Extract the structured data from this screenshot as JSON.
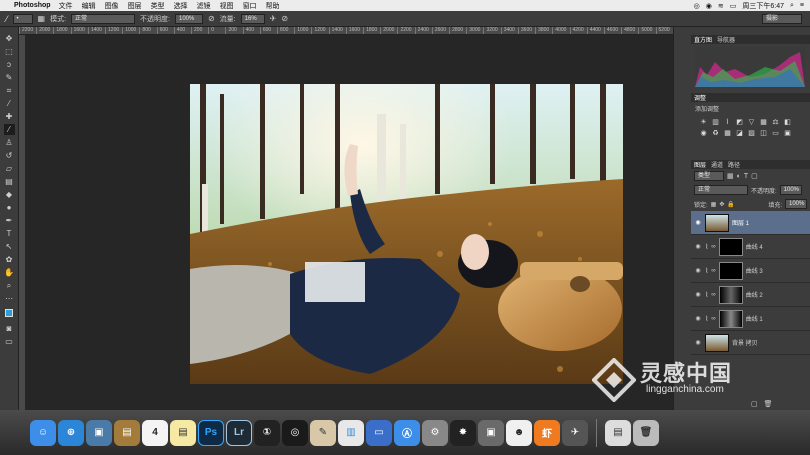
{
  "menubar": {
    "app_name": "Photoshop",
    "items": [
      "文件",
      "编辑",
      "图像",
      "图层",
      "类型",
      "选择",
      "滤镜",
      "视图",
      "窗口",
      "帮助"
    ],
    "clock": "周三下午6:47"
  },
  "options": {
    "mode_label": "模式:",
    "mode_value": "正常",
    "opacity_label": "不透明度:",
    "opacity_value": "100%",
    "flow_label": "流量:",
    "flow_value": "16%",
    "workspace": "摄影"
  },
  "ruler_ticks": [
    "2200",
    "2000",
    "1800",
    "1600",
    "1400",
    "1200",
    "1000",
    "800",
    "600",
    "400",
    "200",
    "0",
    "200",
    "400",
    "600",
    "800",
    "1000",
    "1200",
    "1400",
    "1600",
    "1800",
    "2000",
    "2200",
    "2400",
    "2600",
    "2800",
    "3000",
    "3200",
    "3400",
    "3600",
    "3800",
    "4000",
    "4200",
    "4400",
    "4600",
    "4800",
    "5000",
    "5200"
  ],
  "histogram": {
    "tabs": [
      "直方图",
      "导航器"
    ]
  },
  "adjustments": {
    "tab": "调整",
    "title": "添加调整"
  },
  "layers": {
    "tabs": [
      "图层",
      "通道",
      "路径"
    ],
    "kind_label": "类型",
    "blend_mode": "正常",
    "opacity_label": "不透明度:",
    "opacity_value": "100%",
    "lock_label": "锁定:",
    "fill_label": "填充:",
    "fill_value": "100%",
    "items": [
      {
        "name": "图层 1"
      },
      {
        "name": "曲线 4"
      },
      {
        "name": "曲线 3"
      },
      {
        "name": "曲线 2"
      },
      {
        "name": "曲线 1"
      },
      {
        "name": "背景 拷贝"
      }
    ]
  },
  "dock": {
    "ps_label": "Ps",
    "lr_label": "Lr",
    "calendar_day": "4",
    "xiami_label": "虾"
  },
  "watermark": {
    "title": "灵感中国",
    "url": "lingganchina.com"
  }
}
